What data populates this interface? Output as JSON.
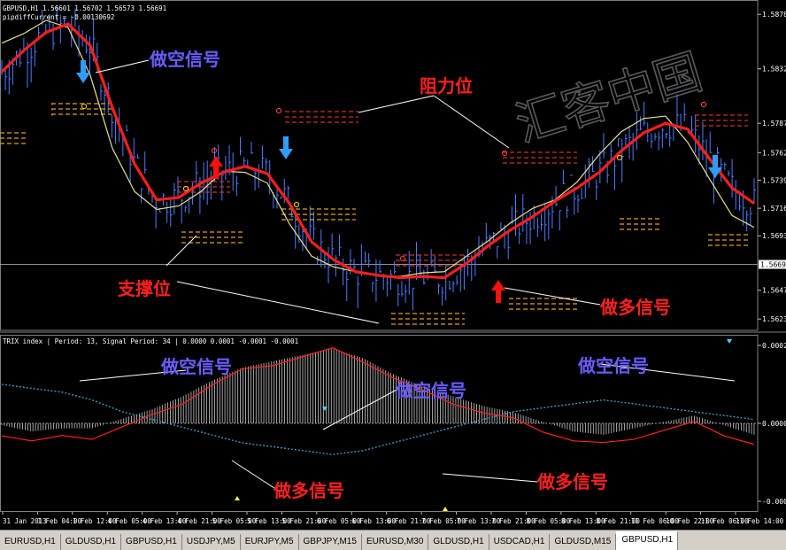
{
  "window": {
    "main_header_line1": "GBPUSD,H1  1.56601 1.56702 1.56573 1.56691",
    "main_header_line2": "pipdiffCurrent = -0.00130692",
    "sub_header": "TRIX index | Period: 13, Signal Period: 34 |  0.0000 0.0001 -0.0001 -0.0001"
  },
  "watermark": "汇客中国",
  "tabs": [
    "EURUSD,H1",
    "GLDUSD,H1",
    "GBPUSD,H1",
    "USDJPY,M5",
    "EURJPY,M5",
    "GBPJPY,M15",
    "EURUSD,M30",
    "GLDUSD,H1",
    "USDCAD,H1",
    "GLDUSD,M15",
    "GBPUSD,H1"
  ],
  "active_tab": 10,
  "annotations": {
    "short_signal": "做空信号",
    "long_signal": "做多信号",
    "resistance": "阻力位",
    "support": "支撑位"
  },
  "colors": {
    "background": "#000000",
    "candles": "#4a7fff",
    "ema_red": "#ff1e1e",
    "ema_yellow": "#e8e090",
    "annotation_blue": "#6a5cff",
    "annotation_red": "#ff2020",
    "down_arrow": "#2f9dff",
    "up_arrow": "#ff1010",
    "resistance_level": "#c83232",
    "support_level": "#e0a020",
    "histogram": "#e6e6e6",
    "trix_signal": "#3aa0d0"
  },
  "chart_data": [
    {
      "type": "line",
      "name": "GBPUSD,H1",
      "price_ticks": [
        "1.58780",
        "1.58325",
        "1.57870",
        "1.57625",
        "1.57395",
        "1.57160",
        "1.56930",
        "1.56691",
        "1.56475",
        "1.56235"
      ],
      "ylim": [
        1.5614,
        1.589
      ],
      "current_price": "1.56691",
      "x_labels": [
        "31 Jan 2013",
        "1 Feb 04:00",
        "1 Feb 12:00",
        "4 Feb 05:00",
        "4 Feb 13:00",
        "4 Feb 21:00",
        "5 Feb 05:00",
        "5 Feb 13:00",
        "5 Feb 21:00",
        "6 Feb 05:00",
        "6 Feb 13:00",
        "6 Feb 21:00",
        "7 Feb 05:00",
        "7 Feb 13:00",
        "7 Feb 21:00",
        "8 Feb 05:00",
        "8 Feb 13:00",
        "8 Feb 21:00",
        "11 Feb 06:00",
        "10 Feb 22:00",
        "11 Feb 06:00",
        "11 Feb 14:00"
      ],
      "series": [
        {
          "type": "line",
          "x": [
            0,
            3,
            6,
            9,
            12,
            15,
            18,
            21,
            24,
            27,
            30,
            33,
            36,
            39,
            42,
            45,
            48,
            51,
            54,
            57,
            60,
            63,
            66,
            69,
            72,
            75,
            78,
            81,
            84,
            87,
            90,
            93,
            96,
            99,
            102
          ],
          "values": [
            1.583,
            1.5848,
            1.5863,
            1.587,
            1.5852,
            1.58,
            1.5753,
            1.5723,
            1.5725,
            1.5737,
            1.5746,
            1.5751,
            1.5745,
            1.572,
            1.5688,
            1.5673,
            1.5663,
            1.566,
            1.5658,
            1.5659,
            1.5658,
            1.567,
            1.5685,
            1.5698,
            1.5709,
            1.5722,
            1.5733,
            1.5746,
            1.5764,
            1.5779,
            1.5787,
            1.5782,
            1.5757,
            1.5733,
            1.572
          ]
        },
        {
          "type": "line",
          "x": [
            0,
            3,
            6,
            9,
            12,
            15,
            18,
            21,
            24,
            27,
            30,
            33,
            36,
            39,
            42,
            45,
            48,
            51,
            54,
            57,
            60,
            63,
            66,
            69,
            72,
            75,
            78,
            81,
            84,
            87,
            90,
            93,
            96,
            99,
            102
          ],
          "values": [
            1.5854,
            1.5862,
            1.5873,
            1.5867,
            1.5827,
            1.5766,
            1.573,
            1.5715,
            1.5718,
            1.573,
            1.5747,
            1.5746,
            1.5737,
            1.5703,
            1.5676,
            1.5667,
            1.5663,
            1.566,
            1.5659,
            1.5662,
            1.5663,
            1.5676,
            1.5689,
            1.5704,
            1.5716,
            1.5723,
            1.5738,
            1.5761,
            1.578,
            1.5791,
            1.5793,
            1.5771,
            1.574,
            1.571,
            1.57
          ]
        }
      ]
    },
    {
      "type": "line",
      "name": "TRIX index",
      "y_ticks": [
        "0.0002",
        "0.0000",
        "-0.0002"
      ],
      "ylim": [
        -0.0002,
        0.0002
      ],
      "series": [
        {
          "type": "line",
          "x": [
            0,
            2,
            4,
            6,
            8,
            10,
            12,
            14,
            16,
            18,
            20,
            22,
            24,
            26,
            28,
            30,
            32,
            34,
            36,
            38,
            40,
            42,
            44,
            46,
            48,
            50
          ],
          "values": [
            -3e-05,
            -5e-05,
            -4e-05,
            -4e-05,
            -1e-05,
            2e-05,
            6e-05,
            0.00011,
            0.00015,
            0.00017,
            0.00019,
            0.00021,
            0.00018,
            0.00013,
            9e-05,
            6e-05,
            3e-05,
            1e-05,
            -2e-05,
            -5e-05,
            -6e-05,
            -4e-05,
            -2e-05,
            0.0,
            -3e-05,
            -6e-05
          ]
        },
        {
          "type": "line",
          "x": [
            0,
            2,
            4,
            6,
            8,
            10,
            12,
            14,
            16,
            18,
            20,
            22,
            24,
            26,
            28,
            30,
            32,
            34,
            36,
            38,
            40,
            42,
            44,
            46,
            48,
            50
          ],
          "values": [
            0.0001,
            9e-05,
            8e-05,
            6e-05,
            3e-05,
            1e-05,
            -1e-05,
            -3e-05,
            -5e-05,
            -6e-05,
            -7e-05,
            -8e-05,
            -7e-05,
            -5e-05,
            -3e-05,
            -1e-05,
            1e-05,
            3e-05,
            4e-05,
            5e-05,
            6e-05,
            5e-05,
            4e-05,
            3e-05,
            2e-05,
            1e-05
          ]
        }
      ]
    }
  ]
}
